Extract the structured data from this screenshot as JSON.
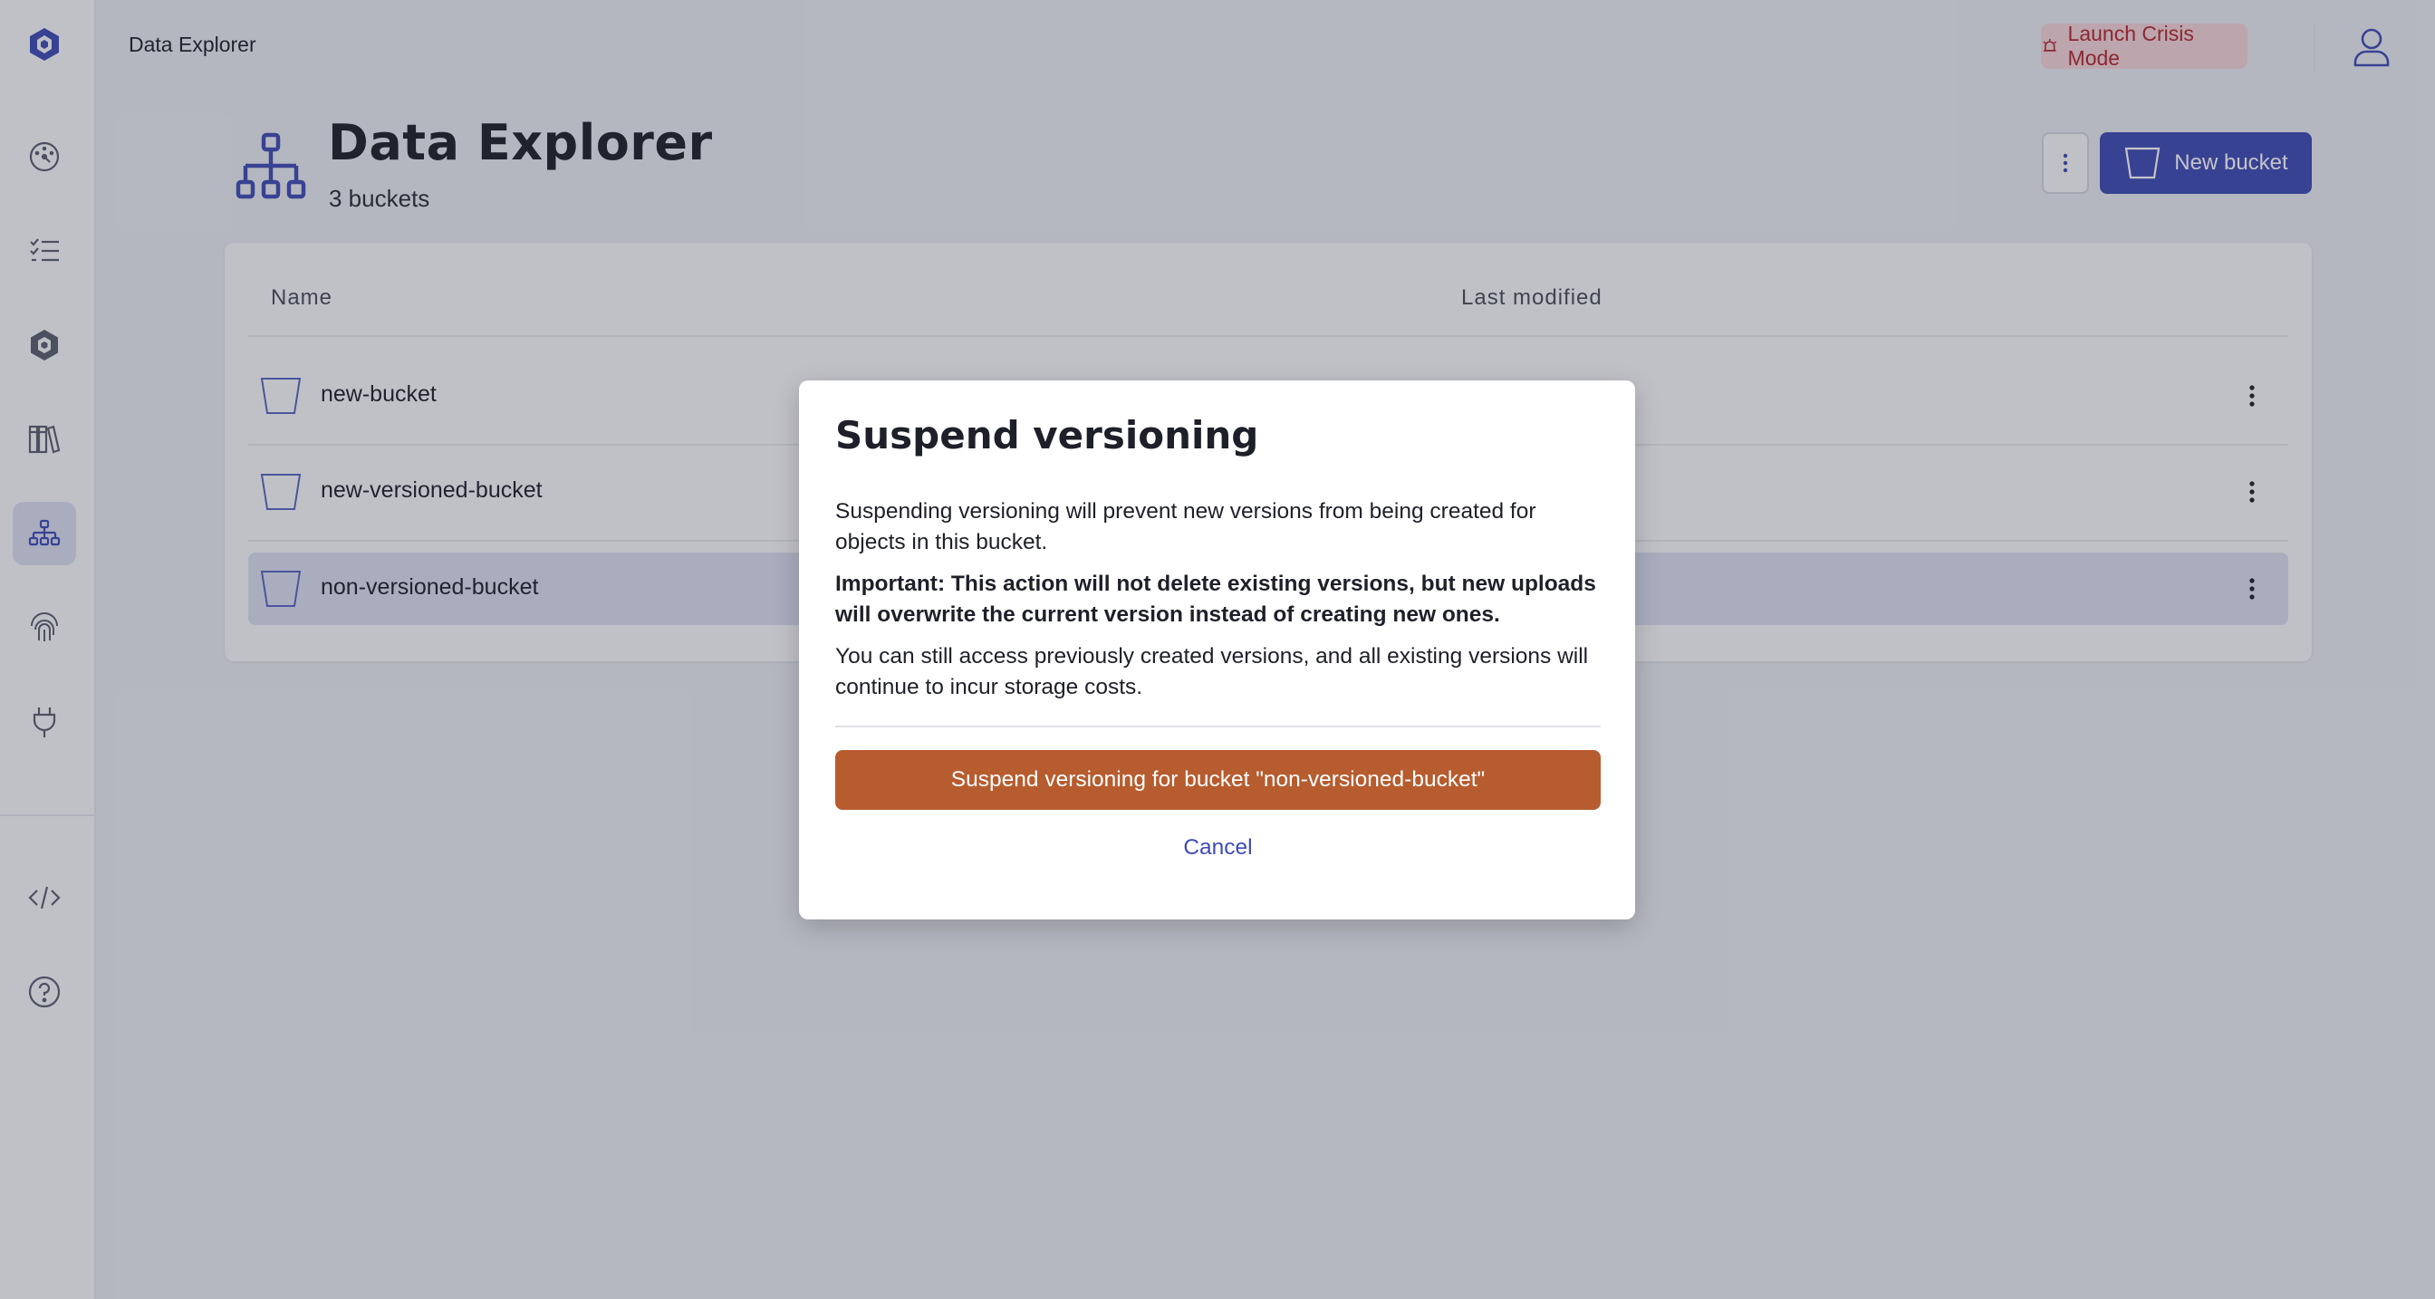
{
  "topbar": {
    "title": "Data Explorer",
    "crisis_label": "Launch Crisis Mode"
  },
  "sidebar": {
    "items": [
      {
        "icon": "logo-icon"
      },
      {
        "icon": "dashboard-gauge-icon"
      },
      {
        "icon": "checklist-icon"
      },
      {
        "icon": "cluster-icon"
      },
      {
        "icon": "library-icon"
      },
      {
        "icon": "data-explorer-icon",
        "active": true
      },
      {
        "icon": "fingerprint-icon"
      },
      {
        "icon": "plug-icon"
      },
      {
        "icon": "code-icon"
      },
      {
        "icon": "help-icon"
      }
    ]
  },
  "page": {
    "title": "Data Explorer",
    "subtitle": "3 buckets",
    "new_button_label": "New bucket"
  },
  "table": {
    "columns": [
      "Name",
      "Last modified"
    ],
    "rows": [
      {
        "name": "new-bucket",
        "selected": false
      },
      {
        "name": "new-versioned-bucket",
        "selected": false
      },
      {
        "name": "non-versioned-bucket",
        "selected": true
      }
    ]
  },
  "modal": {
    "title": "Suspend versioning",
    "paragraph1": "Suspending versioning will prevent new versions from being created for objects in this bucket.",
    "paragraph2": "Important: This action will not delete existing versions, but new uploads will overwrite the current version instead of creating new ones.",
    "paragraph3": "You can still access previously created versions, and all existing versions will continue to incur storage costs.",
    "confirm_label": "Suspend versioning for bucket \"non-versioned-bucket\"",
    "cancel_label": "Cancel"
  },
  "colors": {
    "accent": "#3f4bb5",
    "danger": "#b75c2f",
    "crisis_bg": "#f6d5d8",
    "crisis_text": "#b3262e"
  }
}
